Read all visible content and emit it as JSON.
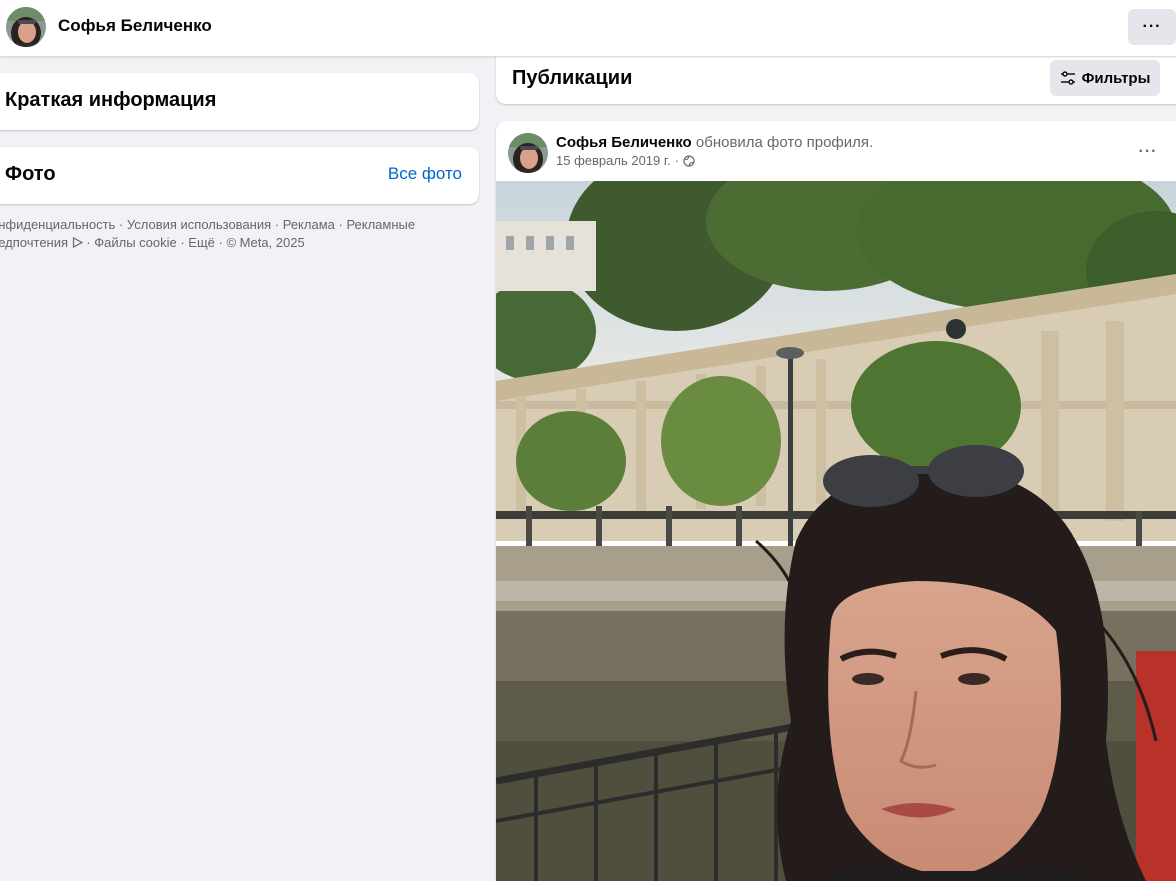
{
  "topbar": {
    "profile_name": "Софья Беличенко",
    "more_label": "···"
  },
  "intro": {
    "title": "Краткая информация"
  },
  "photos": {
    "title": "Фото",
    "all_link": "Все фото"
  },
  "footer": {
    "links": [
      "онфиденциальность",
      "Условия использования",
      "Реклама",
      "Рекламные",
      "редпочтения",
      "Файлы cookie",
      "Ещё"
    ],
    "copyright": "© Meta, 2025",
    "separator": " · ",
    "adchoices_icon": "ad-choices-icon"
  },
  "publications": {
    "title": "Публикации",
    "filter_label": "Фильтры",
    "filter_icon": "sliders-icon"
  },
  "post": {
    "author": "Софья Беличенко",
    "action": " обновила фото профиля.",
    "date": "15 февраль 2019 г.",
    "dot": "·",
    "privacy_icon": "globe-icon",
    "more_label": "···",
    "photo_icon": "photo-image"
  },
  "colors": {
    "background": "#f0f2f5",
    "card": "#ffffff",
    "link": "#0064d1",
    "secondary_text": "#65676b",
    "button_bg": "#e4e6eb"
  }
}
